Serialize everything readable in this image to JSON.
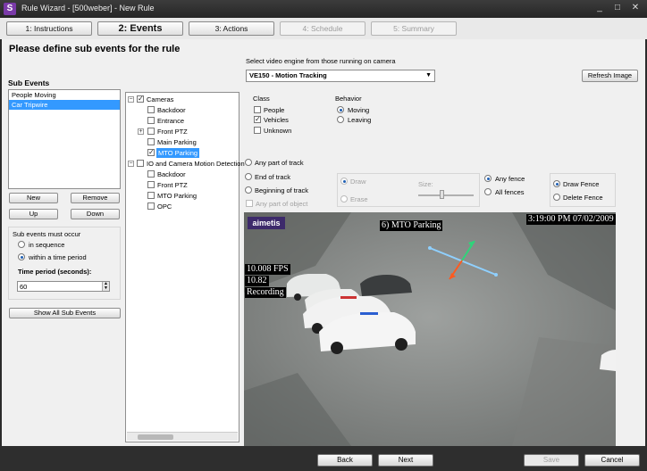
{
  "window": {
    "title": "Rule Wizard - [500weber] - New Rule",
    "app_icon": "S",
    "minimize": "_",
    "maximize": "□",
    "close": "✕"
  },
  "wizard_tabs": [
    {
      "label": "1: Instructions",
      "state": "normal"
    },
    {
      "label": "2: Events",
      "state": "active"
    },
    {
      "label": "3: Actions",
      "state": "normal"
    },
    {
      "label": "4: Schedule",
      "state": "disabled"
    },
    {
      "label": "5: Summary",
      "state": "disabled"
    }
  ],
  "page_title": "Please define sub events for the rule",
  "sub_events": {
    "heading": "Sub Events",
    "items": [
      "People Moving",
      "Car Tripwire"
    ],
    "selected_index": 1,
    "buttons": {
      "new": "New",
      "remove": "Remove",
      "up": "Up",
      "down": "Down"
    },
    "occur_label": "Sub events must occur",
    "occur_options": [
      "in sequence",
      "within a time period"
    ],
    "occur_selected": 1,
    "time_period_label": "Time period (seconds):",
    "time_period_value": "60",
    "show_all": "Show All Sub Events"
  },
  "tree": {
    "cameras_label": "Cameras",
    "cameras": [
      "Backdoor",
      "Entrance",
      "Front PTZ",
      "Main Parking",
      "MTO Parking"
    ],
    "selected_camera": "MTO Parking",
    "io_label": "IO and Camera Motion Detection",
    "io_items": [
      "Backdoor",
      "Front PTZ",
      "MTO Parking",
      "OPC"
    ],
    "expand_symbol": "+",
    "collapse_symbol": "−",
    "check": "✓"
  },
  "engine": {
    "label": "Select video engine from those running on camera",
    "value": "VE150 - Motion Tracking",
    "dropdown_icon": "▼",
    "refresh": "Refresh Image"
  },
  "class_group": {
    "heading": "Class",
    "options": [
      {
        "label": "People",
        "checked": false
      },
      {
        "label": "Vehicles",
        "checked": true
      },
      {
        "label": "Unknown",
        "checked": false
      }
    ]
  },
  "behavior_group": {
    "heading": "Behavior",
    "options": [
      "Moving",
      "Leaving"
    ],
    "selected": 0
  },
  "track_options": {
    "options": [
      "Any part of track",
      "End of track",
      "Beginning of track"
    ],
    "any_part_of_object": "Any part of object"
  },
  "draw_options": {
    "draw": "Draw",
    "erase": "Erase",
    "size_label": "Size:"
  },
  "fence_options": {
    "any_fence": "Any fence",
    "all_fences": "All fences",
    "selected": 0
  },
  "fence_mode": {
    "draw_fence": "Draw Fence",
    "delete_fence": "Delete Fence",
    "selected": 0
  },
  "video": {
    "logo": "aimetis",
    "camera_name": "6) MTO Parking",
    "timestamp": "3:19:00 PM 07/02/2009",
    "fps": "10.008 FPS",
    "value": "10.82",
    "status": "Recording",
    "tripwire_colors": {
      "line": "#8fd0ff",
      "arrow_a": "#2ed47a",
      "arrow_b": "#ff5a1f"
    }
  },
  "footer": {
    "back": "Back",
    "next": "Next",
    "save": "Save",
    "cancel": "Cancel"
  }
}
